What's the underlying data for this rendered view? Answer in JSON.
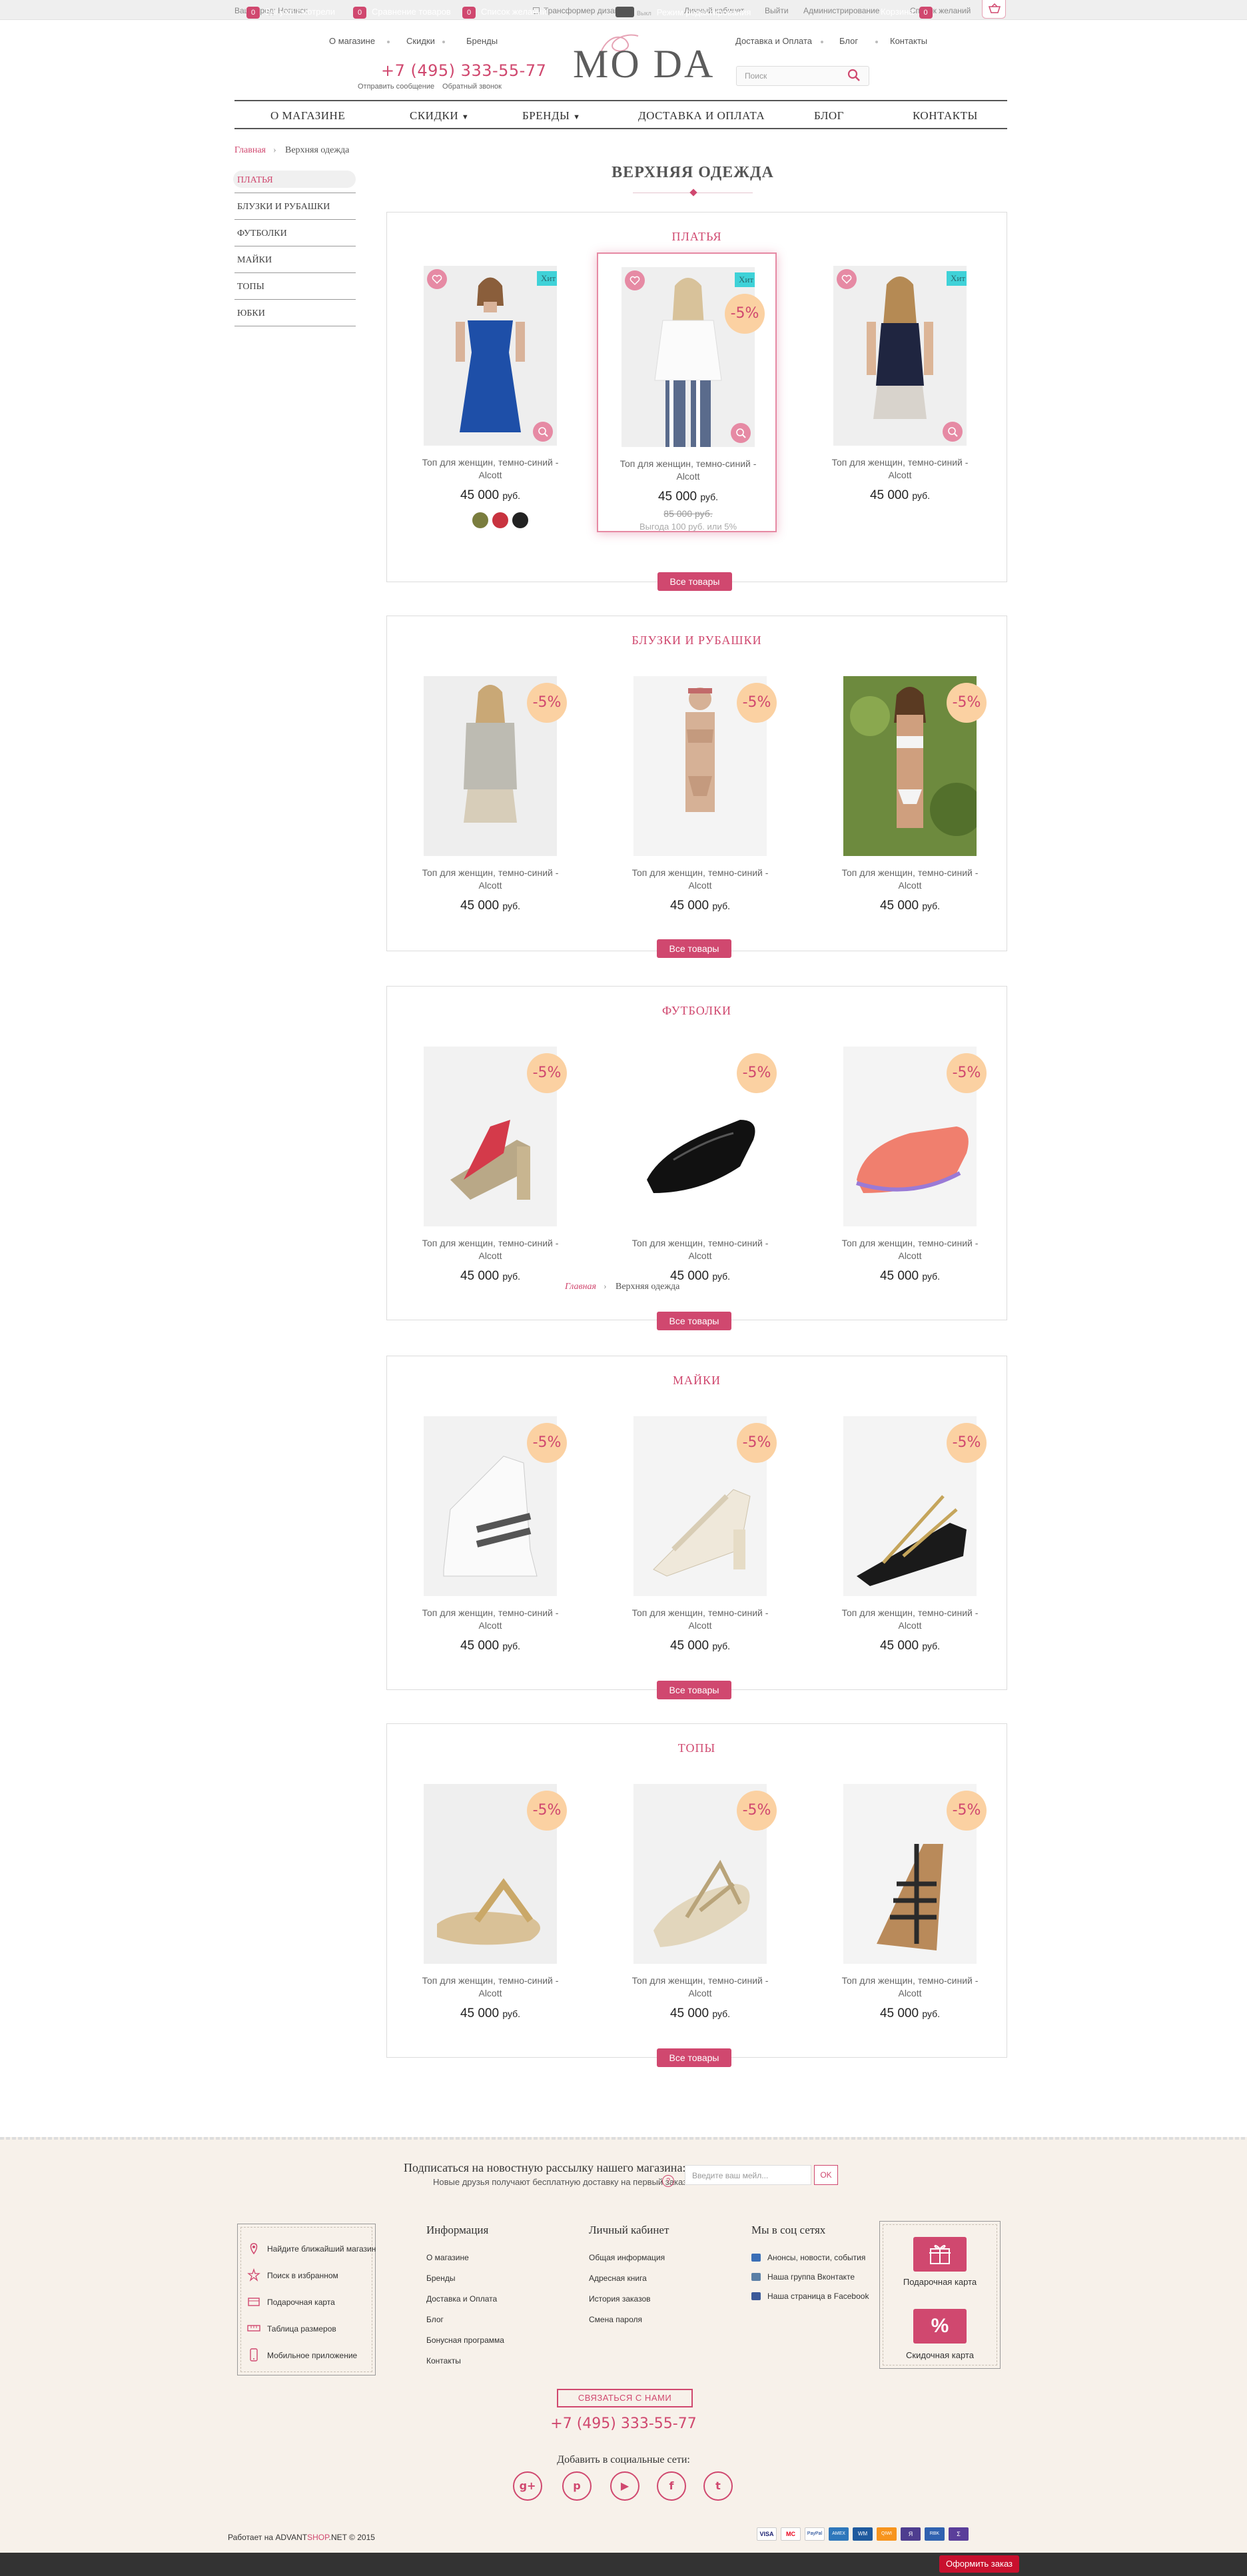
{
  "topbar": {
    "city": "Ваш город: Ногинск",
    "designer": "Трансформер дизайна",
    "cabinet": "Личный кабинет",
    "logout": "Выйти",
    "admin": "Администрирование",
    "wishlist": "Список желаний"
  },
  "header": {
    "nav_left": [
      "О магазине",
      "Скидки",
      "Бренды"
    ],
    "nav_right": [
      "Доставка и Оплата",
      "Блог",
      "Контакты"
    ],
    "phone": "+7 (495) 333-55-77",
    "send_message": "Отправить сообщение",
    "callback": "Обратный звонок",
    "logo": "MO DA",
    "search_placeholder": "Поиск"
  },
  "main_nav": [
    "О МАГАЗИНЕ",
    "СКИДКИ",
    "БРЕНДЫ",
    "ДОСТАВКА И ОПЛАТА",
    "БЛОГ",
    "КОНТАКТЫ"
  ],
  "breadcrumb": {
    "home": "Главная",
    "current": "Верхняя одежда"
  },
  "sidebar": [
    "ПЛАТЬЯ",
    "БЛУЗКИ И РУБАШКИ",
    "ФУТБОЛКИ",
    "МАЙКИ",
    "ТОПЫ",
    "ЮБКИ"
  ],
  "page_title": "ВЕРХНЯЯ ОДЕЖДА",
  "categories": [
    {
      "title": "ПЛАТЬЯ",
      "button": "Все товары",
      "products": [
        {
          "name": "Топ для женщин, темно-синий - Alcott",
          "price": "45 000",
          "currency": "руб.",
          "badge": "Хит",
          "swatches": [
            "#7a7d3e",
            "#c8333f",
            "#222222"
          ]
        },
        {
          "name": "Топ для женщин, темно-синий - Alcott",
          "price": "45 000",
          "currency": "руб.",
          "badge": "Хит",
          "discount": "-5%",
          "old_price": "85 000 руб.",
          "saving": "Выгода 100 руб. или 5%"
        },
        {
          "name": "Топ для женщин, темно-синий - Alcott",
          "price": "45 000",
          "currency": "руб.",
          "badge": "Хит"
        }
      ]
    },
    {
      "title": "БЛУЗКИ И РУБАШКИ",
      "button": "Все товары",
      "products": [
        {
          "name": "Топ для женщин, темно-синий - Alcott",
          "price": "45 000",
          "currency": "руб.",
          "discount": "-5%"
        },
        {
          "name": "Топ для женщин, темно-синий - Alcott",
          "price": "45 000",
          "currency": "руб.",
          "discount": "-5%"
        },
        {
          "name": "Топ для женщин, темно-синий - Alcott",
          "price": "45 000",
          "currency": "руб.",
          "discount": "-5%"
        }
      ]
    },
    {
      "title": "ФУТБОЛКИ",
      "button": "Все товары",
      "products": [
        {
          "name": "Топ для женщин, темно-синий - Alcott",
          "price": "45 000",
          "currency": "руб.",
          "discount": "-5%"
        },
        {
          "name": "Топ для женщин, темно-синий - Alcott",
          "price": "45 000",
          "currency": "руб.",
          "discount": "-5%"
        },
        {
          "name": "Топ для женщин, темно-синий - Alcott",
          "price": "45 000",
          "currency": "руб.",
          "discount": "-5%"
        }
      ]
    },
    {
      "title": "МАЙКИ",
      "button": "Все товары",
      "products": [
        {
          "name": "Топ для женщин, темно-синий - Alcott",
          "price": "45 000",
          "currency": "руб.",
          "discount": "-5%"
        },
        {
          "name": "Топ для женщин, темно-синий - Alcott",
          "price": "45 000",
          "currency": "руб.",
          "discount": "-5%"
        },
        {
          "name": "Топ для женщин, темно-синий - Alcott",
          "price": "45 000",
          "currency": "руб.",
          "discount": "-5%"
        }
      ]
    },
    {
      "title": "ТОПЫ",
      "button": "Все товары",
      "products": [
        {
          "name": "Топ для женщин, темно-синий - Alcott",
          "price": "45 000",
          "currency": "руб.",
          "discount": "-5%"
        },
        {
          "name": "Топ для женщин, темно-синий - Alcott",
          "price": "45 000",
          "currency": "руб.",
          "discount": "-5%"
        },
        {
          "name": "Топ для женщин, темно-синий - Alcott",
          "price": "45 000",
          "currency": "руб.",
          "discount": "-5%"
        }
      ]
    }
  ],
  "stray_breadcrumb": {
    "home": "Главная",
    "current": "Верхняя одежда"
  },
  "newsletter": {
    "title": "Подписаться на новостную рассылку нашего магазина:",
    "subtitle": "Новые друзья получают бесплатную доставку на первый заказ!",
    "help": "?",
    "placeholder": "Введите ваш мейл...",
    "ok": "OK"
  },
  "footer_links": [
    "Найдите ближайший магазин",
    "Поиск в избранном",
    "Подарочная карта",
    "Таблица размеров",
    "Мобильное приложение"
  ],
  "footer_info": {
    "title": "Информация",
    "items": [
      "О магазине",
      "Бренды",
      "Доставка и Оплата",
      "Блог",
      "Бонусная программа",
      "Контакты"
    ]
  },
  "footer_cabinet": {
    "title": "Личный кабинет",
    "items": [
      "Общая информация",
      "Адресная книга",
      "История заказов",
      "Смена пароля"
    ]
  },
  "footer_social": {
    "title": "Мы в соц сетях",
    "items": [
      "Анонсы, новости, события",
      "Наша группа Вконтакте",
      "Наша страница в Facebook"
    ]
  },
  "cards": {
    "gift": "Подарочная карта",
    "discount": "Скидочная карта",
    "discount_symbol": "%"
  },
  "contact_button": "СВЯЗАТЬСЯ С НАМИ",
  "footer_phone": "+7 (495) 333-55-77",
  "social_title": "Добавить в социальные сети:",
  "social_icons": [
    "g+",
    "p",
    "▶",
    "f",
    "t"
  ],
  "powered": {
    "prefix": "Работает на ",
    "brand1": "ADVANT",
    "brand2": "SHOP",
    "suffix": ".NET © 2015"
  },
  "payments": [
    "VISA",
    "MC",
    "PayPal",
    "AMEX",
    "WM",
    "QIWI",
    "Я",
    "RBK",
    "Σ"
  ],
  "bottom_bar": {
    "viewed": {
      "count": "0",
      "label": "Вы уже смотрели"
    },
    "compare": {
      "count": "0",
      "label": "Сравнение товаров"
    },
    "wishlist": {
      "count": "0",
      "label": "Список желаний"
    },
    "edit_mode": "Режим редактирования",
    "toggle": "Выкл",
    "cart": {
      "label": "Корзина",
      "count": "0"
    },
    "order": "Оформить заказ"
  },
  "colors": {
    "accent": "#d0486f",
    "discount_bg": "#fbd1a2",
    "hit_bg": "#3fd2d8",
    "footer_bg": "#f7f1ea"
  }
}
